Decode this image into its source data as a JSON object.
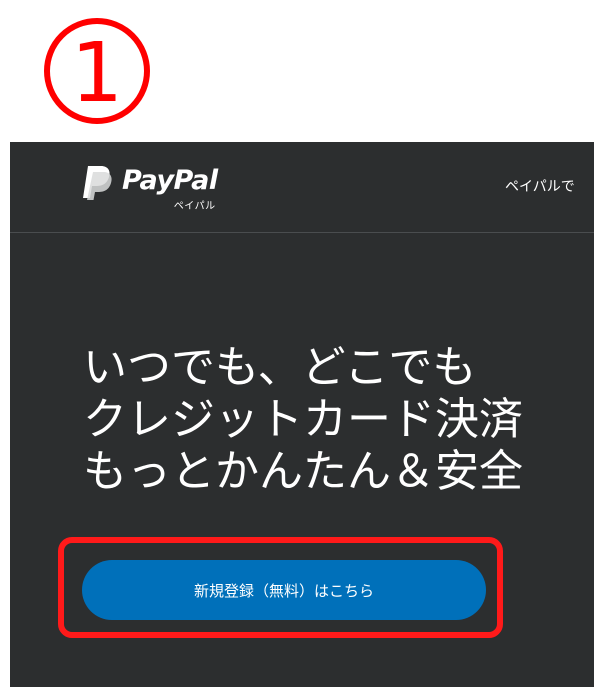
{
  "step": {
    "number": "1",
    "color": "#ff0000"
  },
  "header": {
    "logo_text": "PayPal",
    "logo_subtext": "ペイパル",
    "nav_link": "ペイパルで"
  },
  "hero": {
    "headline_lines": [
      "いつでも、どこでも",
      "クレジットカード決済",
      "もっとかんたん＆安全"
    ],
    "signup_button_label": "新規登録（無料）はこちら"
  },
  "colors": {
    "panel_background": "#2c2e2f",
    "button_blue": "#0070ba",
    "highlight_red": "#ff1a1a"
  }
}
